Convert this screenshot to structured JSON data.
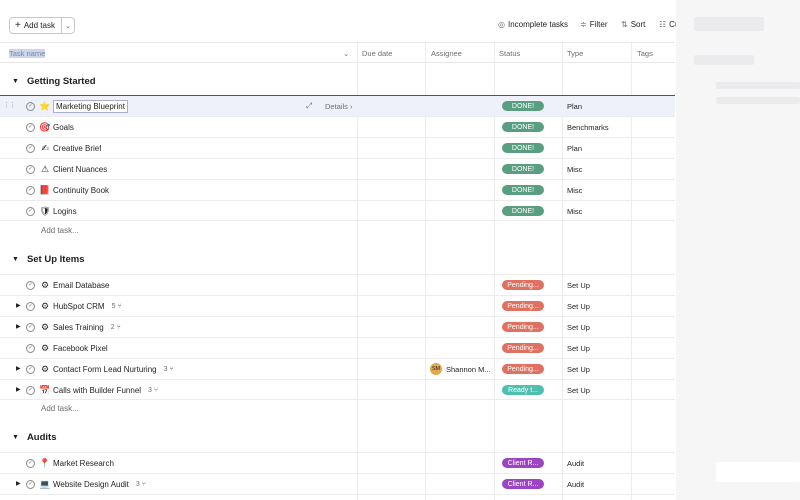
{
  "toolbar": {
    "add_task_label": "Add task",
    "incomplete_label": "Incomplete tasks",
    "filter_label": "Filter",
    "sort_label": "Sort",
    "customize_label": "Cu"
  },
  "columns": {
    "task_name": "Task name",
    "due_date": "Due date",
    "assignee": "Assignee",
    "status": "Status",
    "type": "Type",
    "tags": "Tags"
  },
  "sections": [
    {
      "title": "Getting Started",
      "add_task_label": "Add task...",
      "rows": [
        {
          "emoji": "⭐",
          "name": "Marketing Blueprint",
          "status": "DONE!",
          "status_color": "#5a9e82",
          "type": "Plan",
          "details": "Details"
        },
        {
          "emoji": "🎯",
          "name": "Goals",
          "status": "DONE!",
          "status_color": "#5a9e82",
          "type": "Benchmarks"
        },
        {
          "emoji": "✍",
          "name": "Creative Brief",
          "status": "DONE!",
          "status_color": "#5a9e82",
          "type": "Plan"
        },
        {
          "emoji": "⚠",
          "name": "Client Nuances",
          "status": "DONE!",
          "status_color": "#5a9e82",
          "type": "Misc"
        },
        {
          "emoji": "📕",
          "name": "Continuity Book",
          "status": "DONE!",
          "status_color": "#5a9e82",
          "type": "Misc"
        },
        {
          "emoji": "🛡",
          "name": "Logins",
          "status": "DONE!",
          "status_color": "#5a9e82",
          "type": "Misc"
        }
      ]
    },
    {
      "title": "Set Up Items",
      "add_task_label": "Add task...",
      "rows": [
        {
          "emoji": "⚙",
          "name": "Email Database",
          "status": "Pending...",
          "status_color": "#e0705f",
          "type": "Set Up"
        },
        {
          "emoji": "⚙",
          "name": "HubSpot CRM",
          "subtasks": "5",
          "status": "Pending...",
          "status_color": "#e0705f",
          "type": "Set Up"
        },
        {
          "emoji": "⚙",
          "name": "Sales Training",
          "subtasks": "2",
          "status": "Pending...",
          "status_color": "#e0705f",
          "type": "Set Up"
        },
        {
          "emoji": "⚙",
          "name": "Facebook Pixel",
          "status": "Pending...",
          "status_color": "#e0705f",
          "type": "Set Up"
        },
        {
          "emoji": "⚙",
          "name": "Contact Form Lead Nurturing",
          "subtasks": "3",
          "assignee_initials": "SM",
          "assignee_name": "Shannon M...",
          "status": "Pending...",
          "status_color": "#e0705f",
          "type": "Set Up"
        },
        {
          "emoji": "📅",
          "name": "Calls with Builder Funnel",
          "subtasks": "3",
          "status": "Ready t...",
          "status_color": "#4ec0b0",
          "type": "Set Up"
        }
      ]
    },
    {
      "title": "Audits",
      "rows": [
        {
          "emoji": "📍",
          "name": "Market Research",
          "status": "Client R...",
          "status_color": "#9b45c4",
          "type": "Audit"
        },
        {
          "emoji": "💻",
          "name": "Website Design Audit",
          "subtasks": "3",
          "status": "Client R...",
          "status_color": "#9b45c4",
          "type": "Audit"
        }
      ]
    }
  ]
}
